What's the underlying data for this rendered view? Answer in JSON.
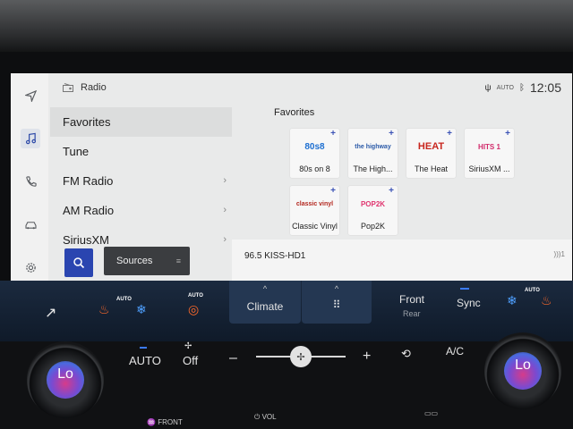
{
  "header": {
    "title": "Radio",
    "time": "12:05",
    "status_small": "AUTO"
  },
  "menu": {
    "items": [
      {
        "label": "Favorites"
      },
      {
        "label": "Tune"
      },
      {
        "label": "FM Radio"
      },
      {
        "label": "AM Radio"
      },
      {
        "label": "SiriusXM"
      }
    ],
    "sources_label": "Sources"
  },
  "favorites": {
    "title": "Favorites",
    "tiles": [
      {
        "logo": "80s8",
        "label": "80s on 8"
      },
      {
        "logo": "the highway",
        "label": "The High..."
      },
      {
        "logo": "HEAT",
        "label": "The Heat"
      },
      {
        "logo": "HITS 1",
        "label": "SiriusXM ..."
      },
      {
        "logo": "classic vinyl",
        "label": "Classic Vinyl"
      },
      {
        "logo": "POP2K",
        "label": "Pop2K"
      }
    ]
  },
  "now_playing": {
    "station": "96.5 KISS-HD1",
    "indicator": "1"
  },
  "climate": {
    "auto_badge": "AUTO",
    "climate_label": "Climate",
    "front_label": "Front",
    "rear_label": "Rear",
    "sync_label": "Sync",
    "auto_label": "AUTO",
    "off_label": "Off",
    "minus": "–",
    "plus": "+",
    "ac_label": "A/C",
    "left_temp": "Lo",
    "right_temp": "Lo",
    "front_defrost": "FRONT",
    "vol": "VOL"
  }
}
